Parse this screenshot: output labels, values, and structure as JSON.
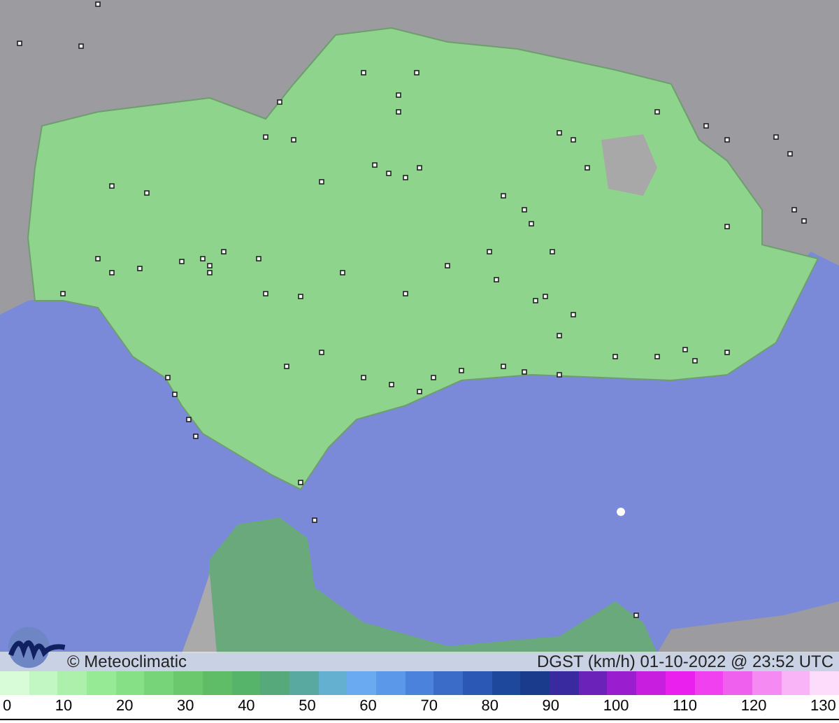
{
  "map": {
    "credit": "© Meteoclimatic",
    "caption": "DGST (km/h)  01-10-2022 @ 23:52 UTC"
  },
  "legend": {
    "swatches": [
      {
        "color": "#d8fbd8"
      },
      {
        "color": "#c2f6c2"
      },
      {
        "color": "#acf0ac"
      },
      {
        "color": "#96ea96"
      },
      {
        "color": "#86e086"
      },
      {
        "color": "#78d478"
      },
      {
        "color": "#6cc86c"
      },
      {
        "color": "#5fbd68"
      },
      {
        "color": "#56b46a"
      },
      {
        "color": "#55a97a"
      },
      {
        "color": "#5aa9a0"
      },
      {
        "color": "#64b0d0"
      },
      {
        "color": "#6aaaf0"
      },
      {
        "color": "#5c98ea"
      },
      {
        "color": "#4a82dc"
      },
      {
        "color": "#3a6cc8"
      },
      {
        "color": "#2a58b4"
      },
      {
        "color": "#1e489c"
      },
      {
        "color": "#1a3a8c"
      },
      {
        "color": "#3a2aa0"
      },
      {
        "color": "#6a22b8"
      },
      {
        "color": "#9a1ed0"
      },
      {
        "color": "#c81ee0"
      },
      {
        "color": "#ea20ee"
      },
      {
        "color": "#f040f0"
      },
      {
        "color": "#f060ee"
      },
      {
        "color": "#f48af2"
      },
      {
        "color": "#f8b4f6"
      },
      {
        "color": "#fcdcfa"
      }
    ],
    "ticks": [
      "0",
      "10",
      "20",
      "30",
      "40",
      "50",
      "60",
      "70",
      "80",
      "90",
      "100",
      "110",
      "120",
      "130"
    ]
  }
}
